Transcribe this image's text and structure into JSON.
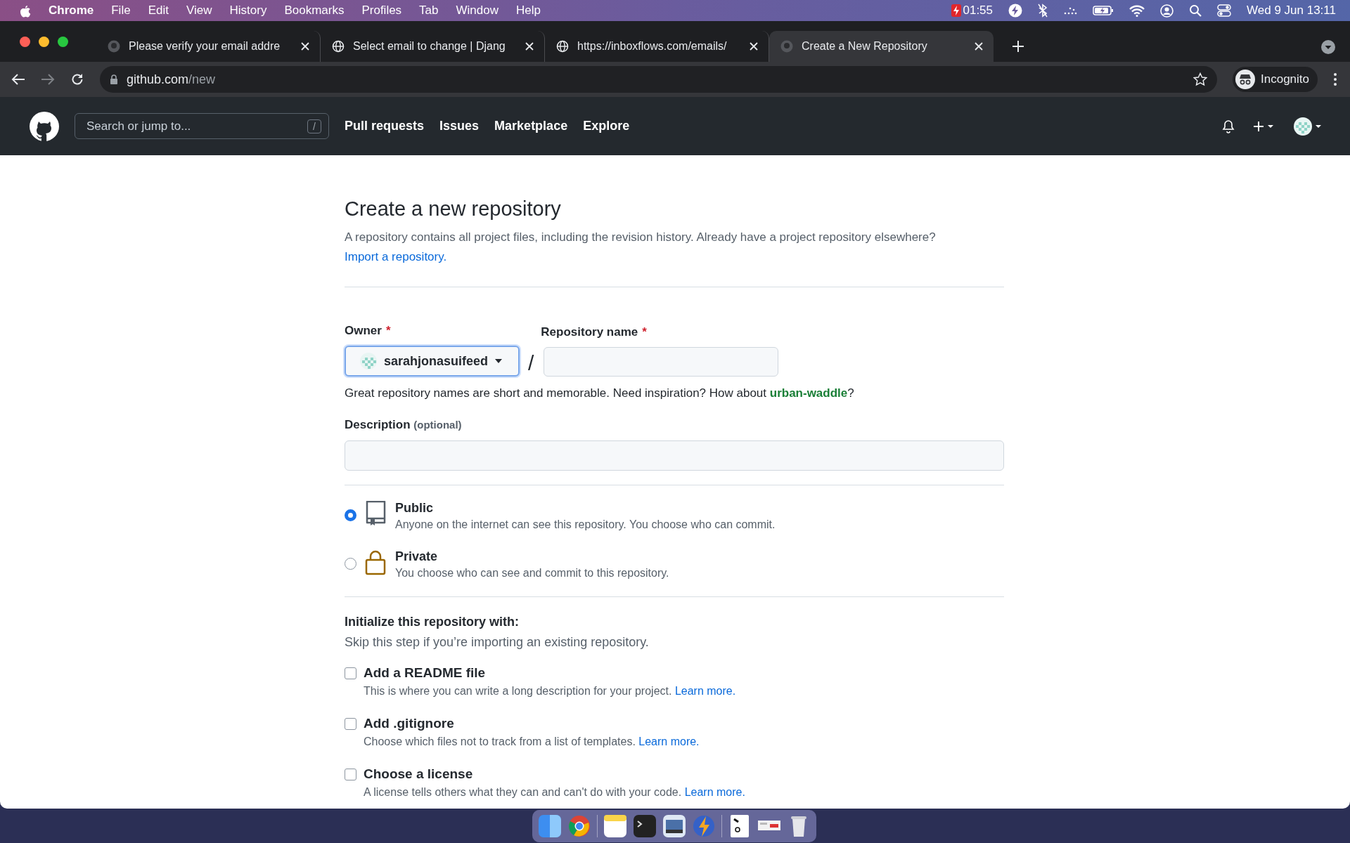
{
  "menubar": {
    "app": "Chrome",
    "items": [
      "File",
      "Edit",
      "View",
      "History",
      "Bookmarks",
      "Profiles",
      "Tab",
      "Window",
      "Help"
    ],
    "timer": "01:55",
    "clock": "Wed 9 Jun  13:11"
  },
  "browser": {
    "tabs": [
      {
        "title": "Please verify your email addre",
        "selected": false,
        "kind": "github"
      },
      {
        "title": "Select email to change | Djang",
        "selected": false,
        "kind": "globe"
      },
      {
        "title": "https://inboxflows.com/emails/",
        "selected": false,
        "kind": "globe"
      },
      {
        "title": "Create a New Repository",
        "selected": true,
        "kind": "github"
      }
    ],
    "address": {
      "host": "github.com",
      "path": "/new"
    },
    "profile": "Incognito"
  },
  "header": {
    "search": {
      "placeholder": "Search or jump to...",
      "key": "/"
    },
    "nav": [
      "Pull requests",
      "Issues",
      "Marketplace",
      "Explore"
    ]
  },
  "form": {
    "title": "Create a new repository",
    "intro": {
      "text": "A repository contains all project files, including the revision history. Already have a project repository elsewhere?",
      "link": "Import a repository."
    },
    "owner": {
      "label": "Owner",
      "required": "*",
      "value": "sarahjonasuifeed"
    },
    "separator": "/",
    "repo_name": {
      "label": "Repository name",
      "required": "*"
    },
    "hint": {
      "text": "Great repository names are short and memorable. Need inspiration? How about",
      "suggestion": "urban-waddle",
      "tail": "?"
    },
    "description": {
      "label": "Description",
      "optional": "(optional)"
    },
    "visibility": [
      {
        "kind": "book",
        "title": "Public",
        "desc": "Anyone on the internet can see this repository. You choose who can commit.",
        "selected": true
      },
      {
        "kind": "lock",
        "title": "Private",
        "desc": "You choose who can see and commit to this repository.",
        "selected": false
      }
    ],
    "init": {
      "heading": "Initialize this repository with:",
      "sub": "Skip this step if you’re importing an existing repository.",
      "options": [
        {
          "label": "Add a README file",
          "desc": "This is where you can write a long description for your project.",
          "link": "Learn more.",
          "checked": false
        },
        {
          "label": "Add .gitignore",
          "desc": "Choose which files not to track from a list of templates.",
          "link": "Learn more.",
          "checked": false
        },
        {
          "label": "Choose a license",
          "desc": "A license tells others what they can and can't do with your code.",
          "link": "Learn more.",
          "checked": false
        }
      ]
    }
  }
}
